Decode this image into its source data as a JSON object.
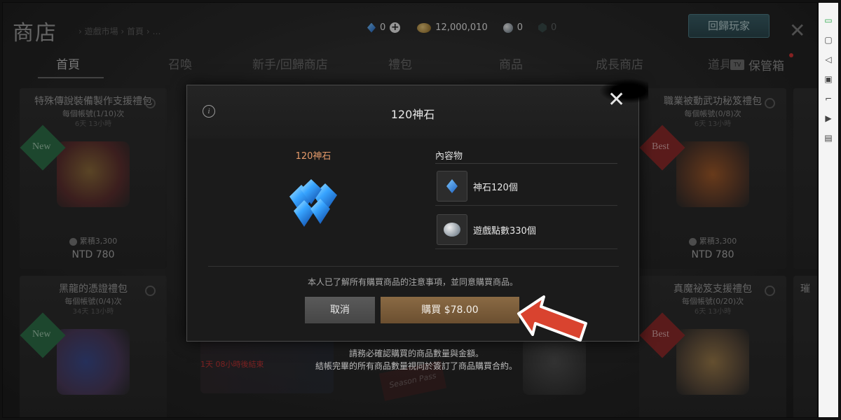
{
  "header": {
    "title": "商店",
    "breadcrumb": "› 遊戲市場 › 首頁 › …",
    "return_button": "回歸玩家",
    "close_glyph": "✕"
  },
  "currency": {
    "gem_value": "0",
    "gold_value": "12,000,010",
    "silver_value": "0",
    "dark_value": "0"
  },
  "tabs": [
    {
      "label": "首頁"
    },
    {
      "label": "召喚"
    },
    {
      "label": "新手/回歸商店"
    },
    {
      "label": "禮包"
    },
    {
      "label": "商品"
    },
    {
      "label": "成長商店"
    },
    {
      "label": "道具"
    },
    {
      "label": "保管箱"
    }
  ],
  "cards": [
    {
      "title": "特殊傳說裝備製作支援禮包",
      "limit": "每個帳號(1/10)次",
      "time": "6天 13小時",
      "badge": "New",
      "accum": "累積3,300",
      "price": "NTD 780"
    },
    {
      "title": "職業被動武功秘笈禮包",
      "limit": "每個帳號(0/8)次",
      "time": "6天 13小時",
      "badge": "Best",
      "accum": "累積3,300",
      "price": "NTD 780"
    },
    {
      "title": "黑龍的憑證禮包",
      "limit": "每個帳號(0/4)次",
      "time": "34天 13小時",
      "badge": "New"
    },
    {
      "title": "真魔祕笈支援禮包",
      "limit": "每個帳號(0/20)次",
      "time": "6天 13小時",
      "badge": "Best"
    },
    {
      "title": "璀"
    }
  ],
  "background_notes": {
    "red_tag": "1天 08小時後結束",
    "season_pass": "Season Pass",
    "purchase_note_line1": "請務必確認購買的商品數量與金額。",
    "purchase_note_line2": "結帳完畢的所有商品數量視同於簽訂了商品購買合約。"
  },
  "dialog": {
    "title": "120神石",
    "item_name": "120神石",
    "contents_label": "內容物",
    "contents": [
      {
        "icon": "diamond-gem-icon",
        "text": "神石120個"
      },
      {
        "icon": "silver-coin-icon",
        "text": "遊戲點數330個"
      }
    ],
    "agreement": "本人已了解所有購買商品的注意事項，並同意購買商品。",
    "cancel_label": "取消",
    "buy_label": "購買  $78.00",
    "close_glyph": "✕",
    "info_glyph": "i"
  },
  "colors": {
    "accent_orange": "#e59a6a",
    "buy_button": "#7a5c3a",
    "cancel_button": "#505050",
    "arrow_red": "#d9432f"
  }
}
